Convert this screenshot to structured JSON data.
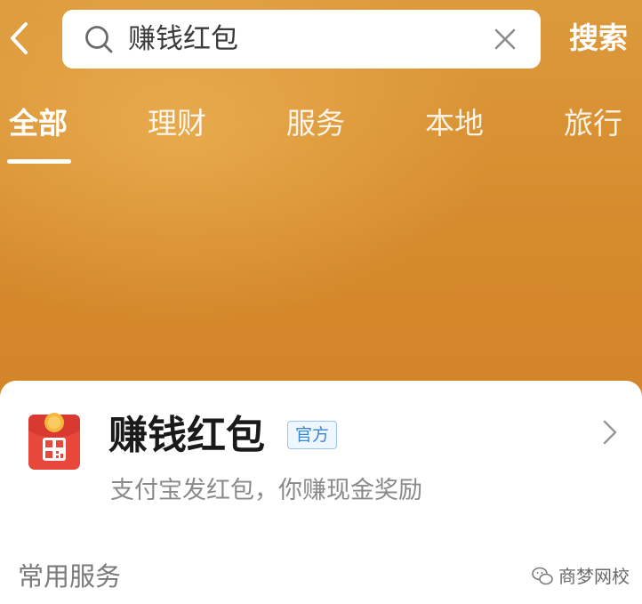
{
  "search": {
    "query": "赚钱红包",
    "submit_label": "搜索"
  },
  "tabs": [
    {
      "label": "全部",
      "active": true
    },
    {
      "label": "理财",
      "active": false
    },
    {
      "label": "服务",
      "active": false
    },
    {
      "label": "本地",
      "active": false
    },
    {
      "label": "旅行",
      "active": false
    }
  ],
  "result": {
    "title": "赚钱红包",
    "badge": "官方",
    "description": "支付宝发红包，你赚现金奖励",
    "icon": "red-envelope-qr-icon"
  },
  "section": {
    "title": "常用服务"
  },
  "watermark": {
    "text": "商梦网校"
  },
  "colors": {
    "header_background": "#d98d2c",
    "badge_text": "#3a87d6",
    "app_icon_red": "#e8473b",
    "app_icon_coin": "#f6b73c"
  },
  "icons": {
    "back": "chevron-left-icon",
    "search": "search-icon",
    "clear": "close-icon",
    "result_arrow": "chevron-right-icon",
    "watermark": "wechat-icon"
  }
}
